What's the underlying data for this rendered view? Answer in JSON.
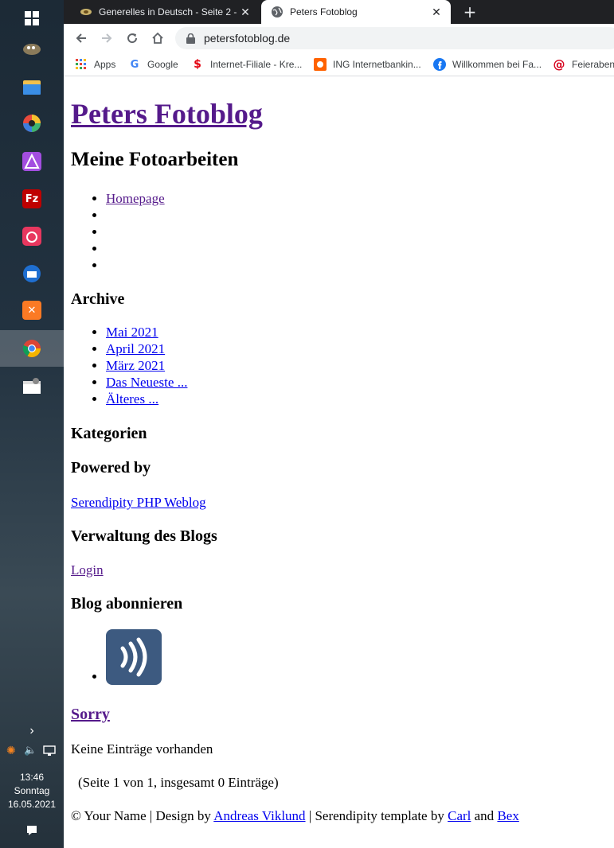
{
  "taskbar": {
    "clock": {
      "time": "13:46",
      "day": "Sonntag",
      "date": "16.05.2021"
    }
  },
  "browser": {
    "tabs": [
      {
        "title": "Generelles in Deutsch - Seite 2 - ",
        "active": false
      },
      {
        "title": "Peters Fotoblog",
        "active": true
      }
    ],
    "close_glyph": "✕",
    "new_tab_glyph": "+",
    "url": "petersfotoblog.de",
    "bookmarks": [
      {
        "label": "Apps",
        "icon": "apps-grid-icon"
      },
      {
        "label": "Google",
        "icon": "google-icon"
      },
      {
        "label": "Internet-Filiale - Kre...",
        "icon": "sparkasse-icon"
      },
      {
        "label": "ING Internetbankin...",
        "icon": "ing-icon"
      },
      {
        "label": "Willkommen bei Fa...",
        "icon": "facebook-icon"
      },
      {
        "label": "Feierabend",
        "icon": "at-icon"
      }
    ]
  },
  "page": {
    "site_title": "Peters Fotoblog",
    "subtitle": "Meine Fotoarbeiten",
    "nav_items": [
      "Homepage",
      "",
      "",
      "",
      ""
    ],
    "archive": {
      "heading": "Archive",
      "items": [
        "Mai 2021",
        "April 2021",
        "März 2021",
        "Das Neueste ...",
        "Älteres ..."
      ]
    },
    "categories_heading": "Kategorien",
    "powered": {
      "heading": "Powered by",
      "link": "Serendipity PHP Weblog"
    },
    "admin": {
      "heading": "Verwaltung des Blogs",
      "link": "Login"
    },
    "subscribe": {
      "heading": "Blog abonnieren"
    },
    "entry_title": "Sorry",
    "no_entries": "Keine Einträge vorhanden",
    "pagination": "(Seite 1 von 1, insgesamt 0 Einträge)",
    "footer": {
      "copyright": "© Your Name | Design by ",
      "designer": "Andreas Viklund",
      "sep": " | Serendipity template by ",
      "author1": "Carl",
      "and": " and ",
      "author2": "Bex"
    }
  }
}
